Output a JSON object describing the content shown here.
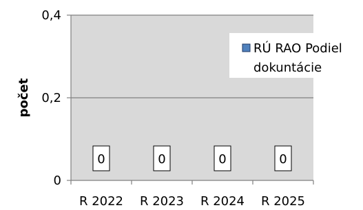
{
  "chart_data": {
    "type": "bar",
    "categories": [
      "R 2022",
      "R 2023",
      "R 2024",
      "R 2025"
    ],
    "series": [
      {
        "name": "RÚ RAO Podiel dokuntácie",
        "values": [
          0,
          0,
          0,
          0
        ],
        "data_labels": [
          "0",
          "0",
          "0",
          "0"
        ],
        "color": "#4f81bd"
      }
    ],
    "title": "",
    "xlabel": "",
    "ylabel": "počet",
    "ylim": [
      0,
      0.4
    ],
    "yticks": [
      0,
      0.2,
      0.4
    ],
    "ytick_labels": [
      "0",
      "0,2",
      "0,4"
    ],
    "grid": true,
    "legend": {
      "placement": "top-right",
      "lines": [
        "RÚ RAO Podiel",
        "dokuntácie"
      ]
    },
    "colors": {
      "plot_background": "#d9d9d9",
      "axis": "#808080",
      "gridline": "#808080",
      "legend_marker_fill": "#4f81bd",
      "legend_marker_border": "#1f3864"
    }
  }
}
